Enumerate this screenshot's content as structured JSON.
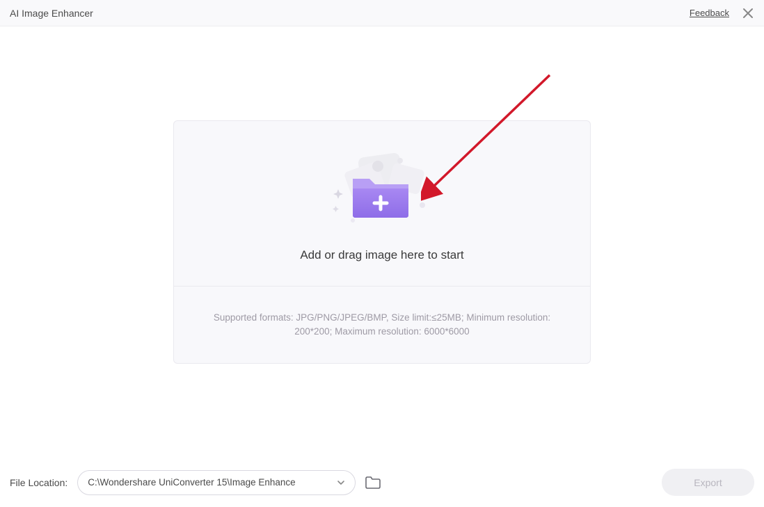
{
  "header": {
    "title": "AI Image Enhancer",
    "feedback_label": "Feedback"
  },
  "dropzone": {
    "instruction": "Add or drag image here to start",
    "supported": "Supported formats: JPG/PNG/JPEG/BMP, Size limit:≤25MB; Minimum resolution: 200*200; Maximum resolution: 6000*6000"
  },
  "footer": {
    "location_label": "File Location:",
    "path": "C:\\Wondershare UniConverter 15\\Image Enhance",
    "export_label": "Export"
  },
  "colors": {
    "folder_primary": "#9b7ded",
    "folder_light": "#b89ff5",
    "arrow": "#d2182a"
  }
}
